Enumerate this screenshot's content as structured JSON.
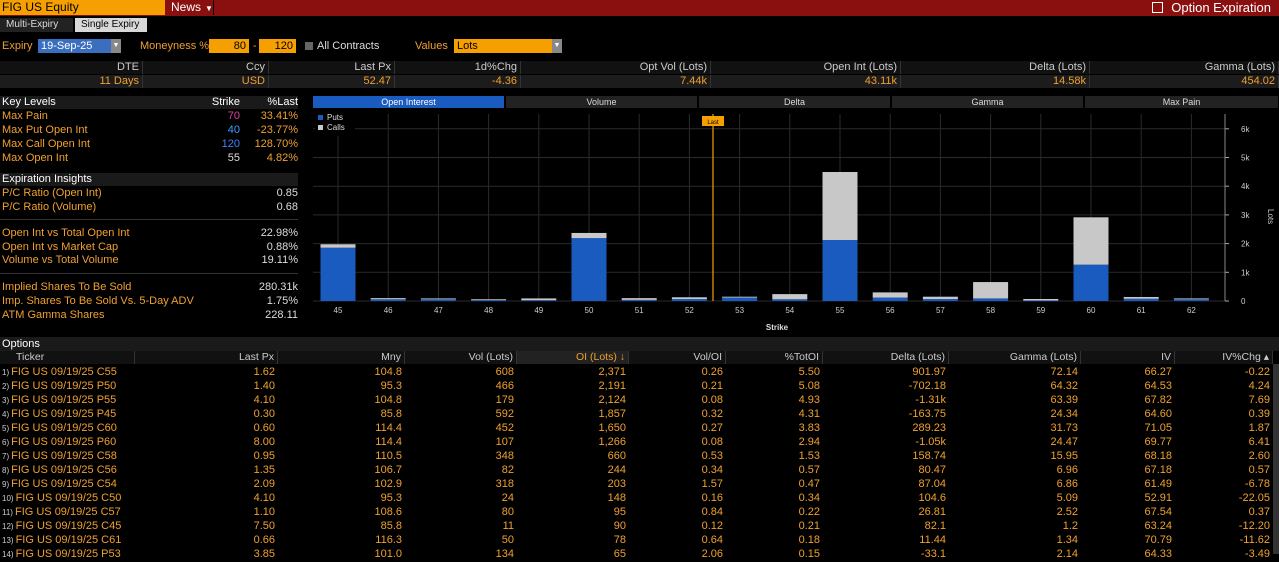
{
  "header": {
    "security": "FIG US Equity",
    "news": "News",
    "title": "Option Expiration"
  },
  "tabs": [
    "Multi-Expiry",
    "Single Expiry"
  ],
  "controls": {
    "expiry_label": "Expiry",
    "expiry_value": "19-Sep-25",
    "moneyness_label": "Moneyness %",
    "mny_low": "80",
    "mny_dash": "-",
    "mny_high": "120",
    "all_contracts": "All Contracts",
    "values_label": "Values",
    "values_value": "Lots"
  },
  "stats": {
    "headers": [
      "DTE",
      "Ccy",
      "Last Px",
      "1d%Chg",
      "Opt Vol (Lots)",
      "Open Int (Lots)",
      "Delta (Lots)",
      "Gamma (Lots)"
    ],
    "values": [
      "11 Days",
      "USD",
      "52.47",
      "-4.36",
      "7.44k",
      "43.11k",
      "14.58k",
      "454.02"
    ]
  },
  "key_levels": {
    "header": [
      "Key Levels",
      "Strike",
      "%Last"
    ],
    "rows": [
      {
        "label": "Max Pain",
        "strike": "70",
        "pct": "33.41%",
        "color": "#e040a0"
      },
      {
        "label": "Max Put Open Int",
        "strike": "40",
        "pct": "-23.77%",
        "color": "#40a0ff"
      },
      {
        "label": "Max Call Open Int",
        "strike": "120",
        "pct": "128.70%",
        "color": "#4080ff"
      },
      {
        "label": "Max Open Int",
        "strike": "55",
        "pct": "4.82%",
        "color": "#f0a030"
      }
    ]
  },
  "insights": {
    "title": "Expiration Insights",
    "rows": [
      [
        "P/C Ratio (Open Int)",
        "0.85"
      ],
      [
        "P/C Ratio (Volume)",
        "0.68"
      ],
      [
        "Open Int vs Total Open Int",
        "22.98%"
      ],
      [
        "Open Int vs Market Cap",
        "0.88%"
      ],
      [
        "Volume vs Total Volume",
        "19.11%"
      ],
      [
        "Implied Shares To Be Sold",
        "280.31k"
      ],
      [
        "Imp. Shares To Be Sold Vs. 5-Day ADV",
        "1.75%"
      ],
      [
        "ATM Gamma Shares",
        "228.11"
      ]
    ]
  },
  "chart_tabs": [
    "Open Interest",
    "Volume",
    "Delta",
    "Gamma",
    "Max Pain"
  ],
  "chart_data": {
    "type": "bar",
    "stacked": true,
    "xlabel": "Strike",
    "ylabel": "Lots",
    "categories": [
      "45",
      "46",
      "47",
      "48",
      "49",
      "50",
      "51",
      "52",
      "53",
      "54",
      "55",
      "56",
      "57",
      "58",
      "59",
      "60",
      "61",
      "62"
    ],
    "series": [
      {
        "name": "Puts",
        "color": "#1a5bc0",
        "values": [
          1857,
          60,
          60,
          40,
          30,
          2191,
          40,
          70,
          120,
          60,
          2124,
          120,
          70,
          90,
          20,
          1266,
          80,
          60
        ]
      },
      {
        "name": "Calls",
        "color": "#c8c8c8",
        "values": [
          120,
          40,
          30,
          20,
          60,
          180,
          60,
          60,
          30,
          180,
          2371,
          180,
          80,
          570,
          50,
          1650,
          60,
          30
        ]
      }
    ],
    "ylim": [
      0,
      7000
    ],
    "yticks": [
      "0",
      "1k",
      "2k",
      "3k",
      "4k",
      "5k",
      "6k"
    ],
    "yvals": [
      0,
      1000,
      2000,
      3000,
      4000,
      5000,
      6000
    ],
    "last_marker": "Last",
    "last_value": 52.47,
    "legend": "top-left"
  },
  "options": {
    "title": "Options",
    "headers": [
      "Ticker",
      "Last Px",
      "Mny",
      "Vol (Lots)",
      "OI (Lots) ↓",
      "Vol/OI",
      "%TotOI",
      "Delta (Lots)",
      "Gamma (Lots)",
      "IV",
      "IV%Chg ▴"
    ],
    "rows": [
      [
        "1",
        "FIG US 09/19/25 C55",
        "1.62",
        "104.8",
        "608",
        "2,371",
        "0.26",
        "5.50",
        "901.97",
        "72.14",
        "66.27",
        "-0.22"
      ],
      [
        "2",
        "FIG US 09/19/25 P50",
        "1.40",
        "95.3",
        "466",
        "2,191",
        "0.21",
        "5.08",
        "-702.18",
        "64.32",
        "64.53",
        "4.24"
      ],
      [
        "3",
        "FIG US 09/19/25 P55",
        "4.10",
        "104.8",
        "179",
        "2,124",
        "0.08",
        "4.93",
        "-1.31k",
        "63.39",
        "67.82",
        "7.69"
      ],
      [
        "4",
        "FIG US 09/19/25 P45",
        "0.30",
        "85.8",
        "592",
        "1,857",
        "0.32",
        "4.31",
        "-163.75",
        "24.34",
        "64.60",
        "0.39"
      ],
      [
        "5",
        "FIG US 09/19/25 C60",
        "0.60",
        "114.4",
        "452",
        "1,650",
        "0.27",
        "3.83",
        "289.23",
        "31.73",
        "71.05",
        "1.87"
      ],
      [
        "6",
        "FIG US 09/19/25 P60",
        "8.00",
        "114.4",
        "107",
        "1,266",
        "0.08",
        "2.94",
        "-1.05k",
        "24.47",
        "69.77",
        "6.41"
      ],
      [
        "7",
        "FIG US 09/19/25 C58",
        "0.95",
        "110.5",
        "348",
        "660",
        "0.53",
        "1.53",
        "158.74",
        "15.95",
        "68.18",
        "2.60"
      ],
      [
        "8",
        "FIG US 09/19/25 C56",
        "1.35",
        "106.7",
        "82",
        "244",
        "0.34",
        "0.57",
        "80.47",
        "6.96",
        "67.18",
        "0.57"
      ],
      [
        "9",
        "FIG US 09/19/25 C54",
        "2.09",
        "102.9",
        "318",
        "203",
        "1.57",
        "0.47",
        "87.04",
        "6.86",
        "61.49",
        "-6.78"
      ],
      [
        "10",
        "FIG US 09/19/25 C50",
        "4.10",
        "95.3",
        "24",
        "148",
        "0.16",
        "0.34",
        "104.6",
        "5.09",
        "52.91",
        "-22.05"
      ],
      [
        "11",
        "FIG US 09/19/25 C57",
        "1.10",
        "108.6",
        "80",
        "95",
        "0.84",
        "0.22",
        "26.81",
        "2.52",
        "67.54",
        "0.37"
      ],
      [
        "12",
        "FIG US 09/19/25 C45",
        "7.50",
        "85.8",
        "11",
        "90",
        "0.12",
        "0.21",
        "82.1",
        "1.2",
        "63.24",
        "-12.20"
      ],
      [
        "13",
        "FIG US 09/19/25 C61",
        "0.66",
        "116.3",
        "50",
        "78",
        "0.64",
        "0.18",
        "11.44",
        "1.34",
        "70.79",
        "-11.62"
      ],
      [
        "14",
        "FIG US 09/19/25 P53",
        "3.85",
        "101.0",
        "134",
        "65",
        "2.06",
        "0.15",
        "-33.1",
        "2.14",
        "64.33",
        "-3.49"
      ]
    ]
  }
}
